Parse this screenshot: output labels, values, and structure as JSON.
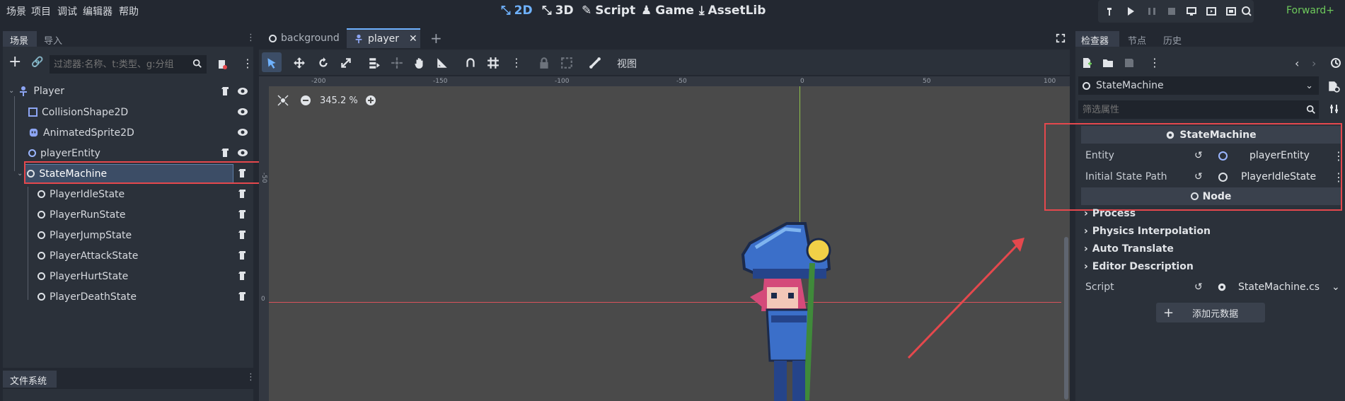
{
  "menu": [
    "场景",
    "项目",
    "调试",
    "编辑器",
    "帮助"
  ],
  "workspaces": [
    {
      "label": "2D",
      "icon": "2d-icon",
      "active": true
    },
    {
      "label": "3D",
      "icon": "3d-icon",
      "active": false
    },
    {
      "label": "Script",
      "icon": "script-icon",
      "active": false
    },
    {
      "label": "Game",
      "icon": "game-icon",
      "active": false
    },
    {
      "label": "AssetLib",
      "icon": "assetlib-icon",
      "active": false
    }
  ],
  "renderer": "Forward+",
  "scene_dock": {
    "tabs": [
      "场景",
      "导入"
    ],
    "filter_placeholder": "过滤器:名称、t:类型、g:分组",
    "nodes": [
      {
        "label": "Player",
        "icon": "character-body-icon",
        "script": true,
        "visible": true
      },
      {
        "label": "CollisionShape2D",
        "icon": "collision-shape-icon",
        "script": false,
        "visible": true
      },
      {
        "label": "AnimatedSprite2D",
        "icon": "animated-sprite-icon",
        "script": false,
        "visible": true
      },
      {
        "label": "playerEntity",
        "icon": "node-icon",
        "script": true,
        "visible": true
      },
      {
        "label": "StateMachine",
        "icon": "node-icon",
        "script": true,
        "visible": false,
        "selected": true
      },
      {
        "label": "PlayerIdleState",
        "icon": "node-icon",
        "script": true
      },
      {
        "label": "PlayerRunState",
        "icon": "node-icon",
        "script": true
      },
      {
        "label": "PlayerJumpState",
        "icon": "node-icon",
        "script": true
      },
      {
        "label": "PlayerAttackState",
        "icon": "node-icon",
        "script": true
      },
      {
        "label": "PlayerHurtState",
        "icon": "node-icon",
        "script": true
      },
      {
        "label": "PlayerDeathState",
        "icon": "node-icon",
        "script": true
      }
    ]
  },
  "filesystem_dock": {
    "tab": "文件系统"
  },
  "editor_tabs": [
    {
      "label": "background",
      "active": false
    },
    {
      "label": "player",
      "active": true
    }
  ],
  "canvas_toolbar": {
    "view_label": "视图"
  },
  "viewport": {
    "zoom": "345.2 %",
    "ruler_labels": [
      "-200",
      "-150",
      "-100",
      "-50",
      "0",
      "50",
      "100"
    ],
    "side_ruler_labels": [
      "-50",
      "0"
    ]
  },
  "inspector": {
    "tabs": [
      "检查器",
      "节点",
      "历史"
    ],
    "object_name": "StateMachine",
    "filter_placeholder": "筛选属性",
    "class_header": "StateMachine",
    "properties": [
      {
        "label": "Entity",
        "value": "playerEntity"
      },
      {
        "label": "Initial State Path",
        "value": "PlayerIdleState"
      }
    ],
    "node_header": "Node",
    "categories": [
      "Process",
      "Physics Interpolation",
      "Auto Translate",
      "Editor Description"
    ],
    "script": {
      "label": "Script",
      "value": "StateMachine.cs"
    },
    "add_metadata": "添加元数据"
  },
  "colors": {
    "accent": "#6fb2ff",
    "highlight_red": "#e5484d",
    "renderer_green": "#6ec95c"
  }
}
